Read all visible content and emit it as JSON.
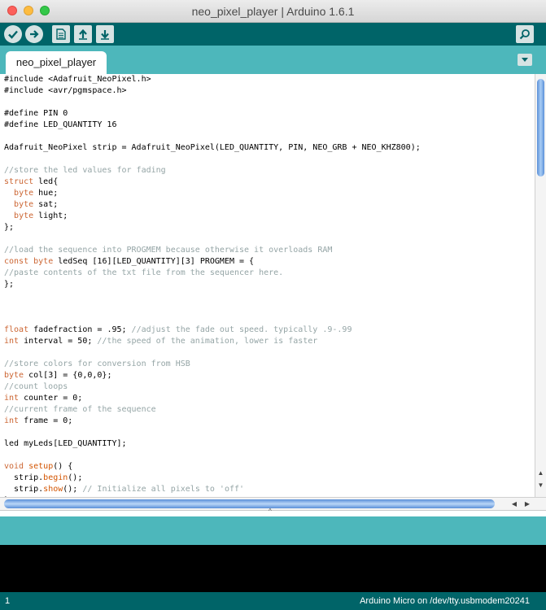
{
  "window": {
    "title": "neo_pixel_player | Arduino 1.6.1"
  },
  "toolbar": {
    "buttons": [
      {
        "name": "verify",
        "icon": "checkmark-icon"
      },
      {
        "name": "upload",
        "icon": "arrow-right-icon"
      },
      {
        "name": "new",
        "icon": "document-icon"
      },
      {
        "name": "open",
        "icon": "arrow-up-icon"
      },
      {
        "name": "save",
        "icon": "arrow-down-icon"
      },
      {
        "name": "serial-monitor",
        "icon": "magnifier-icon"
      }
    ]
  },
  "tabs": [
    {
      "label": "neo_pixel_player"
    }
  ],
  "code_lines": [
    "#include <Adafruit_NeoPixel.h>",
    "#include <avr/pgmspace.h>",
    "",
    "#define PIN 0",
    "#define LED_QUANTITY 16",
    "",
    "Adafruit_NeoPixel strip = Adafruit_NeoPixel(LED_QUANTITY, PIN, NEO_GRB + NEO_KHZ800);",
    "",
    "//store the led values for fading",
    "struct led{",
    "  byte hue;",
    "  byte sat;",
    "  byte light;",
    "};",
    "",
    "//load the sequence into PROGMEM because otherwise it overloads RAM",
    "const byte ledSeq [16][LED_QUANTITY][3] PROGMEM = {",
    "//paste contents of the txt file from the sequencer here.",
    "};",
    "",
    "",
    "",
    "float fadefraction = .95; //adjust the fade out speed. typically .9-.99",
    "int interval = 50; //the speed of the animation, lower is faster",
    "",
    "//store colors for conversion from HSB",
    "byte col[3] = {0,0,0};",
    "//count loops",
    "int counter = 0;",
    "//current frame of the sequence",
    "int frame = 0;",
    "",
    "led myLeds[LED_QUANTITY];",
    "",
    "void setup() {",
    "  strip.begin();",
    "  strip.show(); // Initialize all pixels to 'off'",
    "}"
  ],
  "status": {
    "line_number": "1",
    "board_port": "Arduino Micro on /dev/tty.usbmodem20241"
  },
  "colors": {
    "toolbar": "#006468",
    "tabbar": "#4db7bb",
    "keyword": "#cc6633",
    "comment": "#95a5a6"
  }
}
